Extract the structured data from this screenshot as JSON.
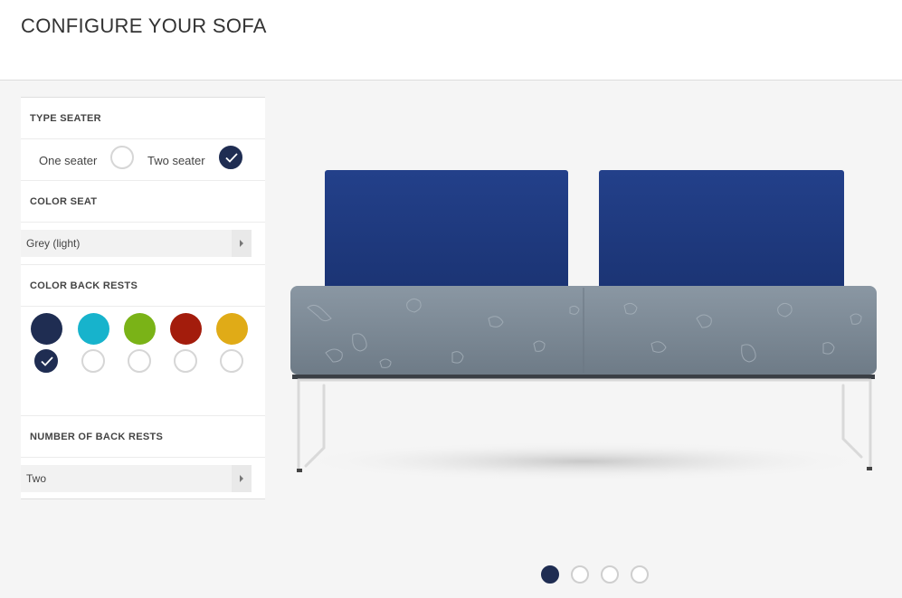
{
  "page": {
    "title": "CONFIGURE YOUR SOFA"
  },
  "type_seater": {
    "heading": "TYPE SEATER",
    "options": [
      {
        "label": "One seater",
        "selected": false
      },
      {
        "label": "Two seater",
        "selected": true
      }
    ]
  },
  "color_seat": {
    "heading": "COLOR SEAT",
    "value": "Grey (light)"
  },
  "color_back_rests": {
    "heading": "COLOR BACK RESTS",
    "swatches": [
      {
        "color": "#1f2d52",
        "selected": true
      },
      {
        "color": "#17b3cc",
        "selected": false
      },
      {
        "color": "#7ab317",
        "selected": false
      },
      {
        "color": "#a31c0c",
        "selected": false
      },
      {
        "color": "#e0ab17",
        "selected": false
      }
    ]
  },
  "number_back_rests": {
    "heading": "NUMBER OF BACK RESTS",
    "value": "Two"
  },
  "carousel": {
    "count": 4,
    "active": 1
  },
  "colors": {
    "accent": "#1f2d52",
    "backrest": "#203a80",
    "seat": "#7d8a96",
    "frame": "#d9d9d9"
  },
  "icons": {
    "check": "check-icon",
    "dropdown": "chevron-right-icon"
  }
}
